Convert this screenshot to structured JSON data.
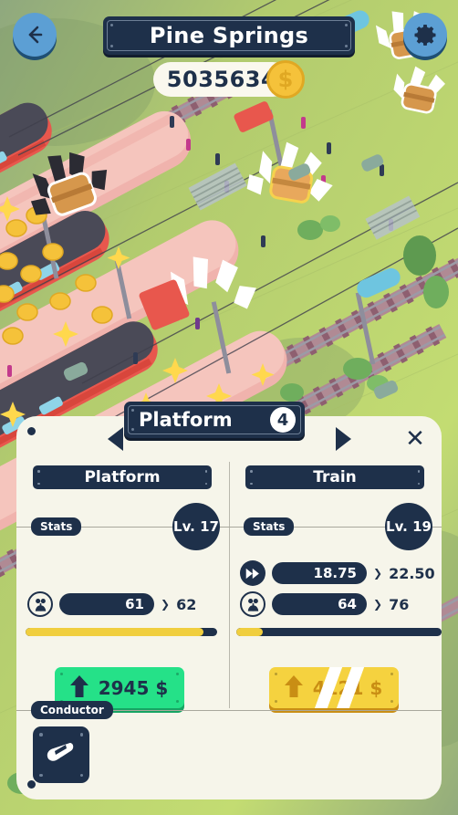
{
  "hud": {
    "back_icon": "back-arrow-icon",
    "settings_icon": "gear-icon",
    "title": "Pine Springs",
    "coins": "5035634",
    "coin_icon": "$"
  },
  "panel": {
    "header": {
      "title": "Platform",
      "badge": "4",
      "prev_icon": "chevron-left-icon",
      "next_icon": "chevron-right-icon",
      "close_icon": "✕"
    },
    "columns": [
      {
        "name": "platform",
        "label": "Platform",
        "stats_tag": "Stats",
        "level": "Lv. 17",
        "stats": [
          {
            "icon": "passengers-icon",
            "icon_style": "light",
            "current": "61",
            "arrow": "❯",
            "next": "62"
          }
        ],
        "progress_percent": 93,
        "action": {
          "style": "green",
          "icon": "upgrade-arrow-icon",
          "price": "2945 $",
          "locked": false
        }
      },
      {
        "name": "train",
        "label": "Train",
        "stats_tag": "Stats",
        "level": "Lv. 19",
        "stats": [
          {
            "icon": "speed-icon",
            "icon_style": "dark",
            "current": "18.75",
            "arrow": "❯",
            "next": "22.50"
          },
          {
            "icon": "passengers-icon",
            "icon_style": "light",
            "current": "64",
            "arrow": "❯",
            "next": "76"
          }
        ],
        "progress_percent": 13,
        "action": {
          "style": "yellow",
          "icon": "upgrade-arrow-icon",
          "price": "4121 $",
          "locked": true
        }
      }
    ],
    "conductor": {
      "tag": "Conductor",
      "card_icon": "conductor-whistle-icon"
    }
  },
  "colors": {
    "navy": "#1e304a",
    "panel_bg": "#f6f5ea",
    "accent_green": "#25e188",
    "accent_yellow": "#f5d23f",
    "progress_yellow": "#f0ce3e",
    "button_blue": "#5c9fd4",
    "coin_gold": "#f5c23a"
  }
}
